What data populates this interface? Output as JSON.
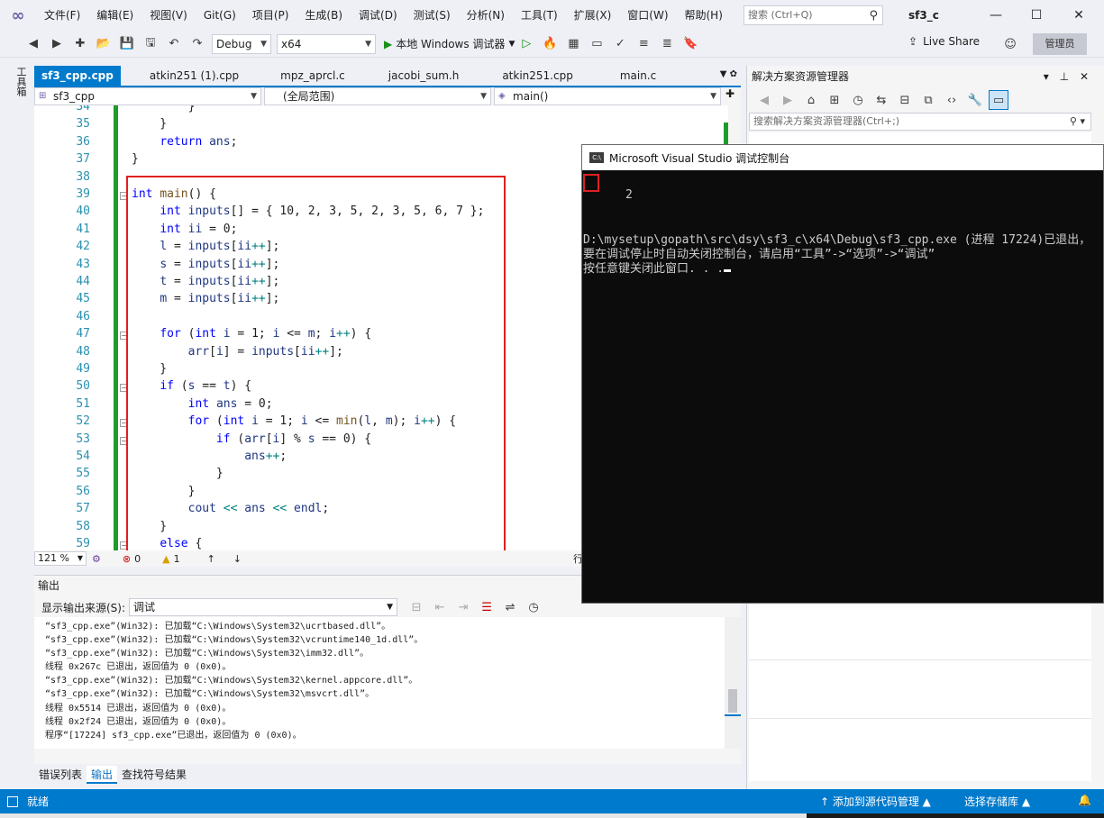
{
  "menu": {
    "items": [
      "文件(F)",
      "编辑(E)",
      "视图(V)",
      "Git(G)",
      "项目(P)",
      "生成(B)",
      "调试(D)",
      "测试(S)",
      "分析(N)",
      "工具(T)",
      "扩展(X)",
      "窗口(W)",
      "帮助(H)"
    ],
    "search_placeholder": "搜索 (Ctrl+Q)",
    "solution_title": "sf3_c"
  },
  "toolbar": {
    "config": "Debug",
    "platform": "x64",
    "run_label": "本地 Windows 调试器",
    "liveshare": "Live Share",
    "admin": "管理员"
  },
  "toolbox": {
    "label": "工具箱"
  },
  "editor": {
    "tabs": [
      "sf3_cpp.cpp",
      "atkin251 (1).cpp",
      "mpz_aprcl.c",
      "jacobi_sum.h",
      "atkin251.cpp",
      "main.c"
    ],
    "nav_project": "sf3_cpp",
    "nav_scope": "(全局范围)",
    "nav_member": "main()",
    "zoom": "121 %",
    "errors": "0",
    "warnings": "1",
    "row_label": "行"
  },
  "code_lines": [
    {
      "ln": "34",
      "text": "        }"
    },
    {
      "ln": "35",
      "text": "    }"
    },
    {
      "ln": "36",
      "text": "    return ans;"
    },
    {
      "ln": "37",
      "text": "}"
    },
    {
      "ln": "38",
      "text": ""
    },
    {
      "ln": "39",
      "text": "int main() {"
    },
    {
      "ln": "40",
      "text": "    int inputs[] = { 10, 2, 3, 5, 2, 3, 5, 6, 7 };"
    },
    {
      "ln": "41",
      "text": "    int ii = 0;"
    },
    {
      "ln": "42",
      "text": "    l = inputs[ii++];"
    },
    {
      "ln": "43",
      "text": "    s = inputs[ii++];"
    },
    {
      "ln": "44",
      "text": "    t = inputs[ii++];"
    },
    {
      "ln": "45",
      "text": "    m = inputs[ii++];"
    },
    {
      "ln": "46",
      "text": ""
    },
    {
      "ln": "47",
      "text": "    for (int i = 1; i <= m; i++) {"
    },
    {
      "ln": "48",
      "text": "        arr[i] = inputs[ii++];"
    },
    {
      "ln": "49",
      "text": "    }"
    },
    {
      "ln": "50",
      "text": "    if (s == t) {"
    },
    {
      "ln": "51",
      "text": "        int ans = 0;"
    },
    {
      "ln": "52",
      "text": "        for (int i = 1; i <= min(l, m); i++) {"
    },
    {
      "ln": "53",
      "text": "            if (arr[i] % s == 0) {"
    },
    {
      "ln": "54",
      "text": "                ans++;"
    },
    {
      "ln": "55",
      "text": "            }"
    },
    {
      "ln": "56",
      "text": "        }"
    },
    {
      "ln": "57",
      "text": "        cout << ans << endl;"
    },
    {
      "ln": "58",
      "text": "    }"
    },
    {
      "ln": "59",
      "text": "    else {"
    }
  ],
  "output": {
    "title": "输出",
    "source_label": "显示输出来源(S):",
    "source_value": "调试",
    "lines": [
      "“sf3_cpp.exe”(Win32): 已加载“C:\\Windows\\System32\\ucrtbased.dll”。",
      "“sf3_cpp.exe”(Win32): 已加载“C:\\Windows\\System32\\vcruntime140_1d.dll”。",
      "“sf3_cpp.exe”(Win32): 已加载“C:\\Windows\\System32\\imm32.dll”。",
      "线程 0x267c 已退出，返回值为 0 (0x0)。",
      "“sf3_cpp.exe”(Win32): 已加载“C:\\Windows\\System32\\kernel.appcore.dll”。",
      "“sf3_cpp.exe”(Win32): 已加载“C:\\Windows\\System32\\msvcrt.dll”。",
      "线程 0x5514 已退出，返回值为 0 (0x0)。",
      "线程 0x2f24 已退出，返回值为 0 (0x0)。",
      "程序“[17224] sf3_cpp.exe”已退出，返回值为 0 (0x0)。"
    ]
  },
  "bottom_tabs": [
    "错误列表",
    "输出",
    "查找符号结果"
  ],
  "solution_explorer": {
    "title": "解决方案资源管理器",
    "search_placeholder": "搜索解决方案资源管理器(Ctrl+;)"
  },
  "console": {
    "title": "Microsoft Visual Studio 调试控制台",
    "result": "2",
    "lines": [
      "",
      "D:\\mysetup\\gopath\\src\\dsy\\sf3_c\\x64\\Debug\\sf3_cpp.exe (进程 17224)已退出，",
      "要在调试停止时自动关闭控制台，请启用“工具”->“选项”->“调试”",
      "按任意键关闭此窗口. . ."
    ]
  },
  "status": {
    "ready": "就绪",
    "add_source": "↑ 添加到源代码管理 ▲",
    "select_repo": "选择存储库 ▲"
  },
  "colors": {
    "accent": "#007acc",
    "keyword": "#0000ff",
    "annotation_red": "#e02020",
    "change_green": "#1e9c2a"
  }
}
